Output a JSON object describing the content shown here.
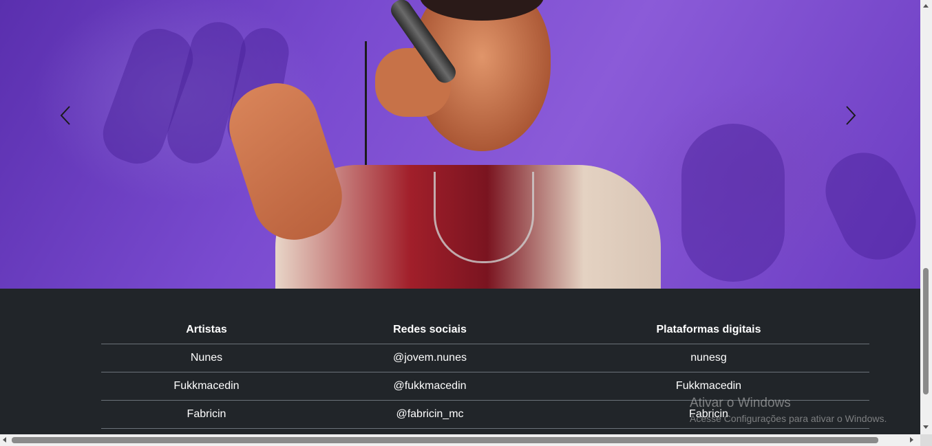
{
  "carousel": {
    "prev_icon": "chevron-left-icon",
    "next_icon": "chevron-right-icon",
    "arrow_color": "#1a1a1a"
  },
  "table": {
    "headers": [
      "Artistas",
      "Redes sociais",
      "Plataformas digitais"
    ],
    "rows": [
      [
        "Nunes",
        "@jovem.nunes",
        "nunesg"
      ],
      [
        "Fukkmacedin",
        "@fukkmacedin",
        "Fukkmacedin"
      ],
      [
        "Fabricin",
        "@fabricin_mc",
        "Fabricin"
      ]
    ]
  },
  "watermark": {
    "title": "Ativar o Windows",
    "subtitle": "Acesse Configurações para ativar o Windows."
  },
  "colors": {
    "page_bg": "#212529",
    "text": "#ffffff",
    "row_border": "#6c737a"
  }
}
